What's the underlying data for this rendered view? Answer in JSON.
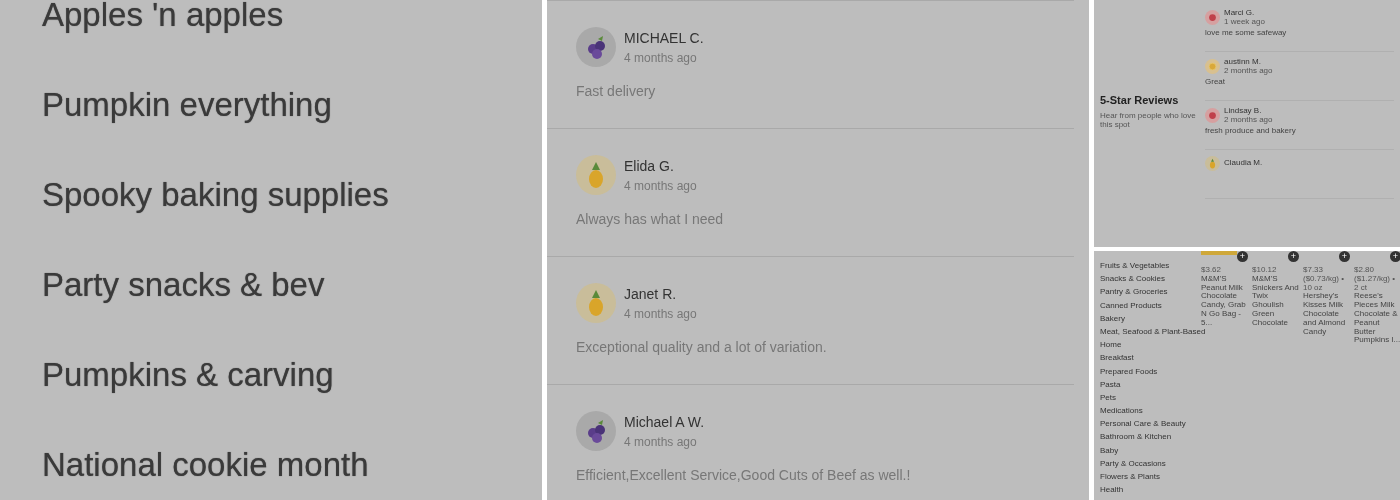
{
  "collections": {
    "items": [
      {
        "label": "Apples 'n apples"
      },
      {
        "label": "Pumpkin everything"
      },
      {
        "label": "Spooky baking supplies"
      },
      {
        "label": "Party snacks & bev"
      },
      {
        "label": "Pumpkins & carving"
      },
      {
        "label": "National cookie month"
      }
    ]
  },
  "reviews": [
    {
      "kind": "blueberry",
      "name": "MICHAEL C.",
      "time": "4 months ago",
      "text": "Fast delivery"
    },
    {
      "kind": "pineapple",
      "name": "Elida G.",
      "time": "4 months ago",
      "text": "Always has what I need"
    },
    {
      "kind": "pineapple",
      "name": "Janet R.",
      "time": "4 months ago",
      "text": "Exceptional quality and a lot of variation."
    },
    {
      "kind": "blueberry",
      "name": "Michael A W.",
      "time": "4 months ago",
      "text": "Efficient,Excellent Service,Good Cuts of Beef as well.!"
    }
  ],
  "five_star": {
    "title": "5-Star Reviews",
    "subtitle": "Hear from people who love this spot",
    "reviews": [
      {
        "kind": "tomato",
        "name": "Marci G.",
        "time": "1 week ago",
        "text": "love me some safeway"
      },
      {
        "kind": "citrus",
        "name": "austinn M.",
        "time": "2 months ago",
        "text": "Great"
      },
      {
        "kind": "tomato",
        "name": "Lindsay B.",
        "time": "2 months ago",
        "text": "fresh produce and bakery"
      },
      {
        "kind": "pineapple",
        "name": "Claudia M."
      }
    ]
  },
  "store": {
    "categories": [
      "Fruits & Vegetables",
      "Snacks & Cookies",
      "Pantry & Groceries",
      "Canned Products",
      "Bakery",
      "Meat, Seafood & Plant-Based",
      "Home",
      "Breakfast",
      "Prepared Foods",
      "Pasta",
      "Pets",
      "Medications",
      "Personal Care & Beauty",
      "Bathroom & Kitchen",
      "Baby",
      "Party & Occasions",
      "Flowers & Plants",
      "Health"
    ],
    "products": [
      {
        "add": "+",
        "price": "$3.62",
        "description": "M&M'S Peanut Milk Chocolate Candy, Grab N Go Bag - 5..."
      },
      {
        "add": "+",
        "price": "$10.12",
        "description": "M&M'S Snickers And Twix Ghoulish Green Chocolate"
      },
      {
        "add": "+",
        "price": "$7.33 ($0.73/kg) • 10 oz",
        "description": "Hershey's Kisses Milk Chocolate and Almond Candy"
      },
      {
        "add": "+",
        "price": "$2.80 ($1.27/kg) • 2 ct",
        "description": "Reese's Pieces Milk Chocolate & Peanut Butter Pumpkins I..."
      }
    ]
  }
}
